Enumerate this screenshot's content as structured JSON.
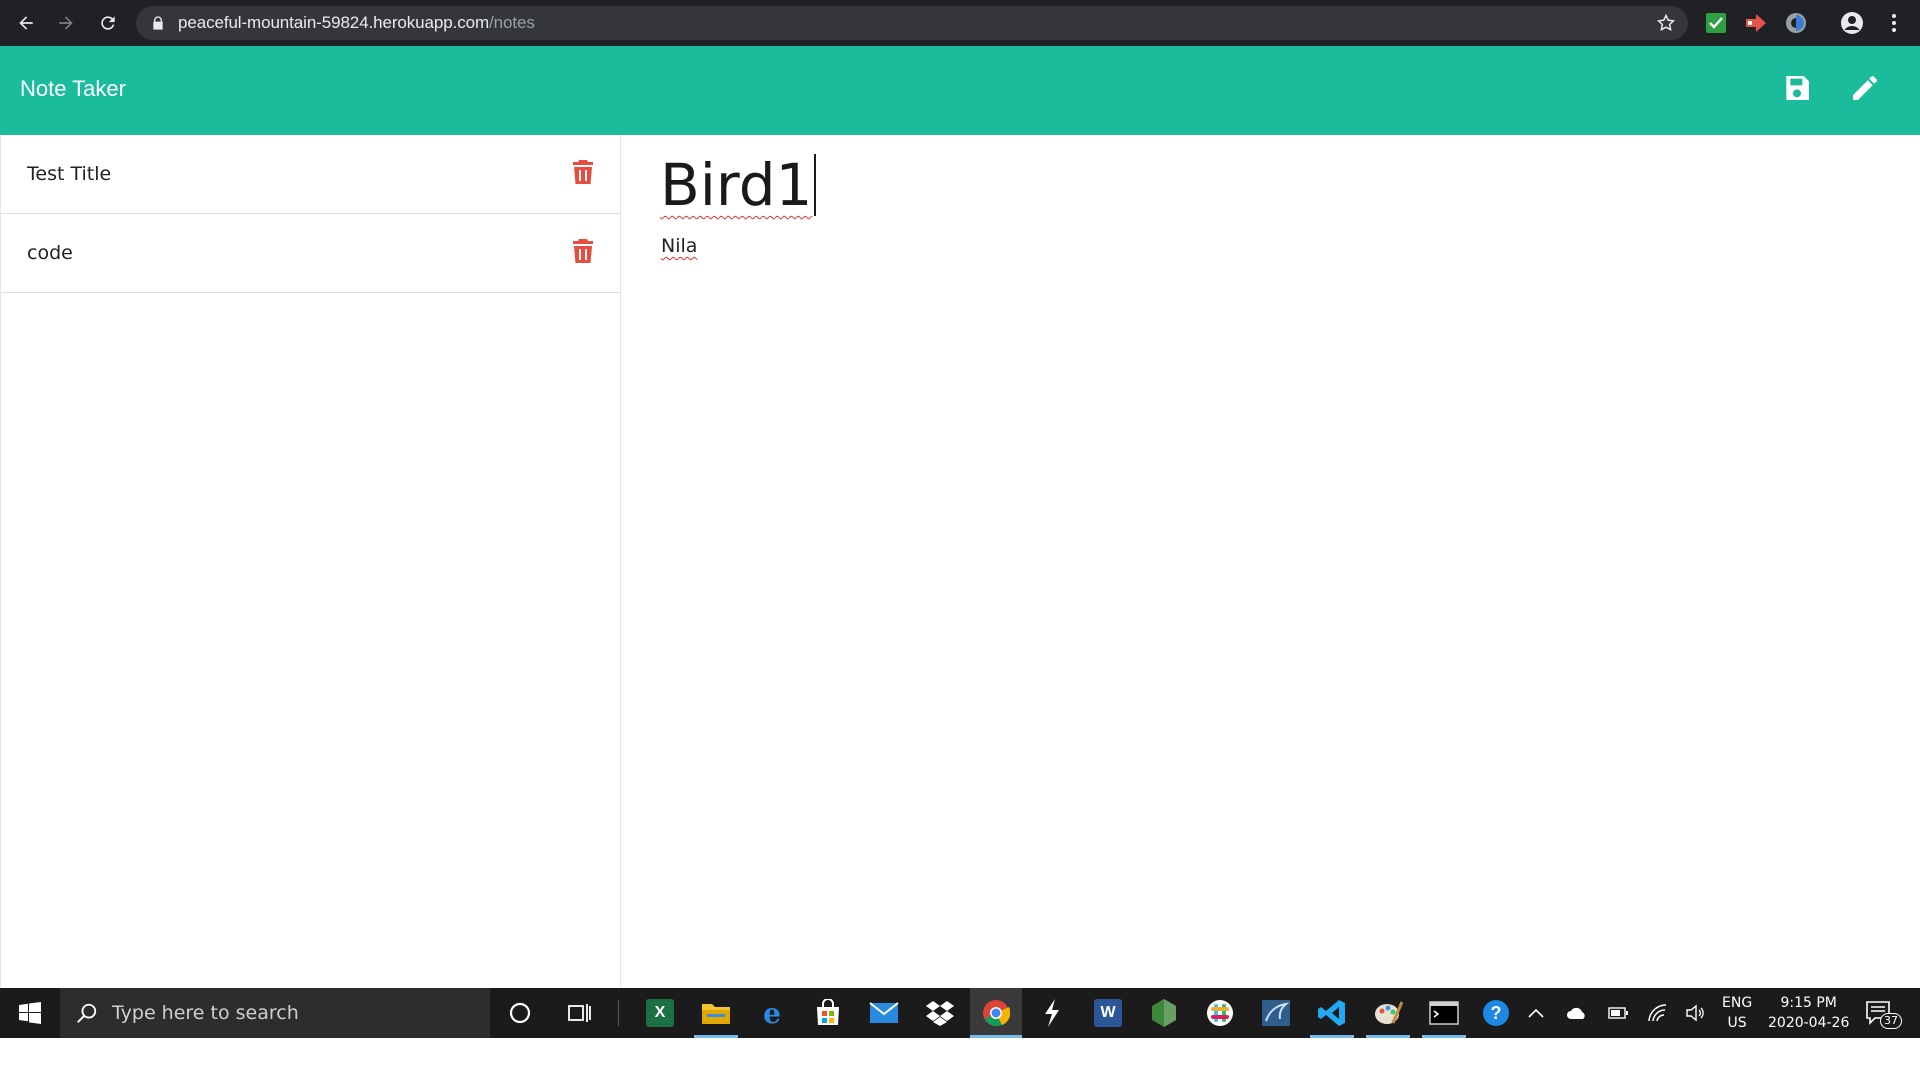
{
  "browser": {
    "url_host": "peaceful-mountain-59824.herokuapp.com",
    "url_path": "/notes"
  },
  "app": {
    "title": "Note Taker",
    "accent_color": "#1abc9c",
    "header_icons": [
      "save-icon",
      "pencil-icon"
    ]
  },
  "notes": [
    {
      "title": "Test Title"
    },
    {
      "title": "code"
    }
  ],
  "editor": {
    "title_value": "Bird1",
    "body_value": "Nila"
  },
  "taskbar": {
    "search_placeholder": "Type here to search",
    "apps": [
      "excel",
      "file-explorer",
      "edge",
      "store",
      "mail",
      "dropbox",
      "chrome",
      "app",
      "word",
      "node",
      "slack",
      "app",
      "vscode",
      "paint",
      "terminal"
    ],
    "lang_line1": "ENG",
    "lang_line2": "US",
    "time": "9:15 PM",
    "date": "2020-04-26",
    "notification_count": "37"
  }
}
